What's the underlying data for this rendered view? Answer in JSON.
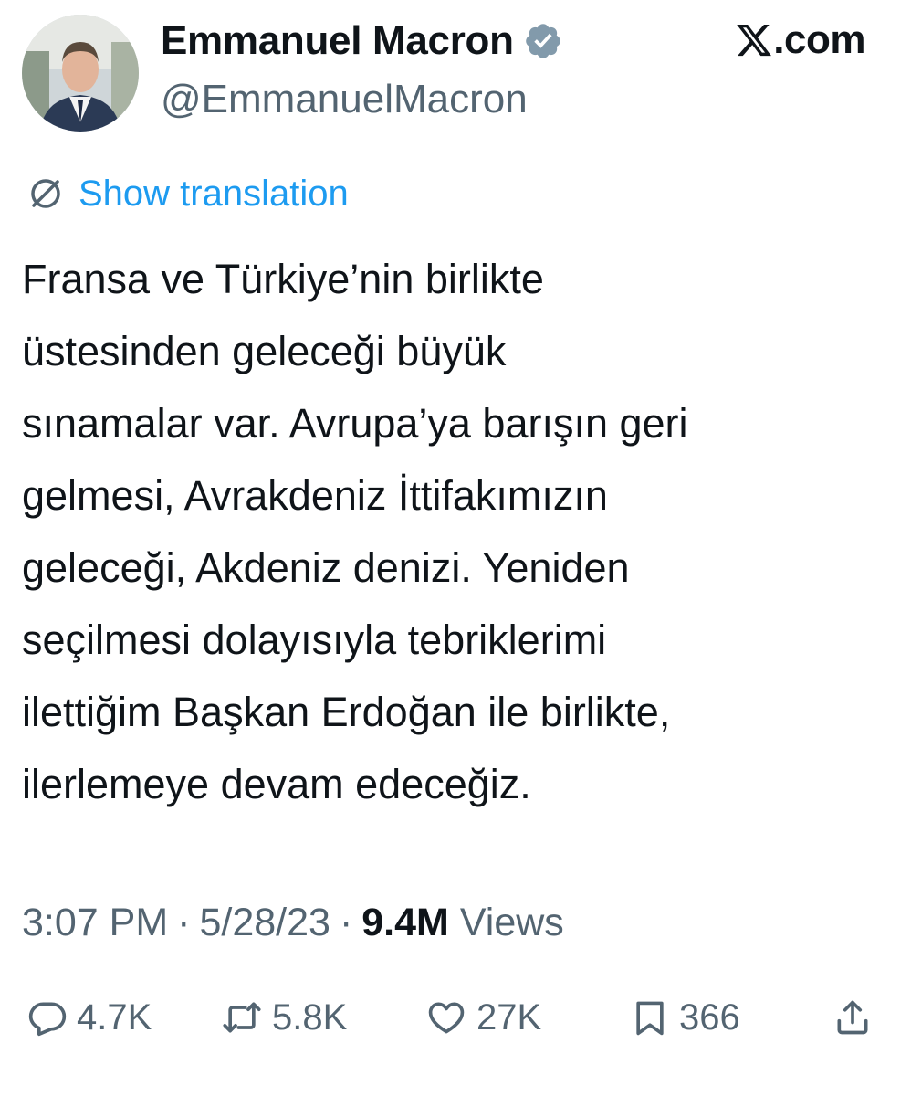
{
  "author": {
    "name": "Emmanuel Macron",
    "handle": "@EmmanuelMacron",
    "avatar": "avatar-photo",
    "verified_icon": "verified-badge-icon",
    "verified_color": "#829aab"
  },
  "brand": {
    "logo_icon": "x-logo-icon",
    "suffix": ".com"
  },
  "translation": {
    "icon": "globe-icon",
    "label": "Show translation",
    "color": "#1d9bf0"
  },
  "tweet": {
    "lines": [
      "Fransa ve Türkiye’nin birlikte",
      "üstesinden geleceği büyük",
      "sınamalar var. Avrupa’ya barışın geri",
      "gelmesi, Avrakdeniz İttifakımızın",
      "geleceği, Akdeniz denizi. Yeniden",
      "seçilmesi dolayısıyla tebriklerimi",
      "ilettiğim Başkan Erdoğan ile birlikte,",
      "ilerlemeye devam edeceğiz."
    ]
  },
  "meta": {
    "time": "3:07 PM",
    "separator": "·",
    "date": "5/28/23",
    "views_count": "9.4M",
    "views_label": "Views"
  },
  "actions": {
    "reply": {
      "icon": "reply-icon",
      "count": "4.7K"
    },
    "repost": {
      "icon": "repost-icon",
      "count": "5.8K"
    },
    "like": {
      "icon": "heart-icon",
      "count": "27K"
    },
    "bookmark": {
      "icon": "bookmark-icon",
      "count": "366"
    },
    "share": {
      "icon": "share-icon"
    }
  },
  "colors": {
    "text": "#0f1419",
    "secondary": "#536471",
    "link": "#1d9bf0"
  }
}
